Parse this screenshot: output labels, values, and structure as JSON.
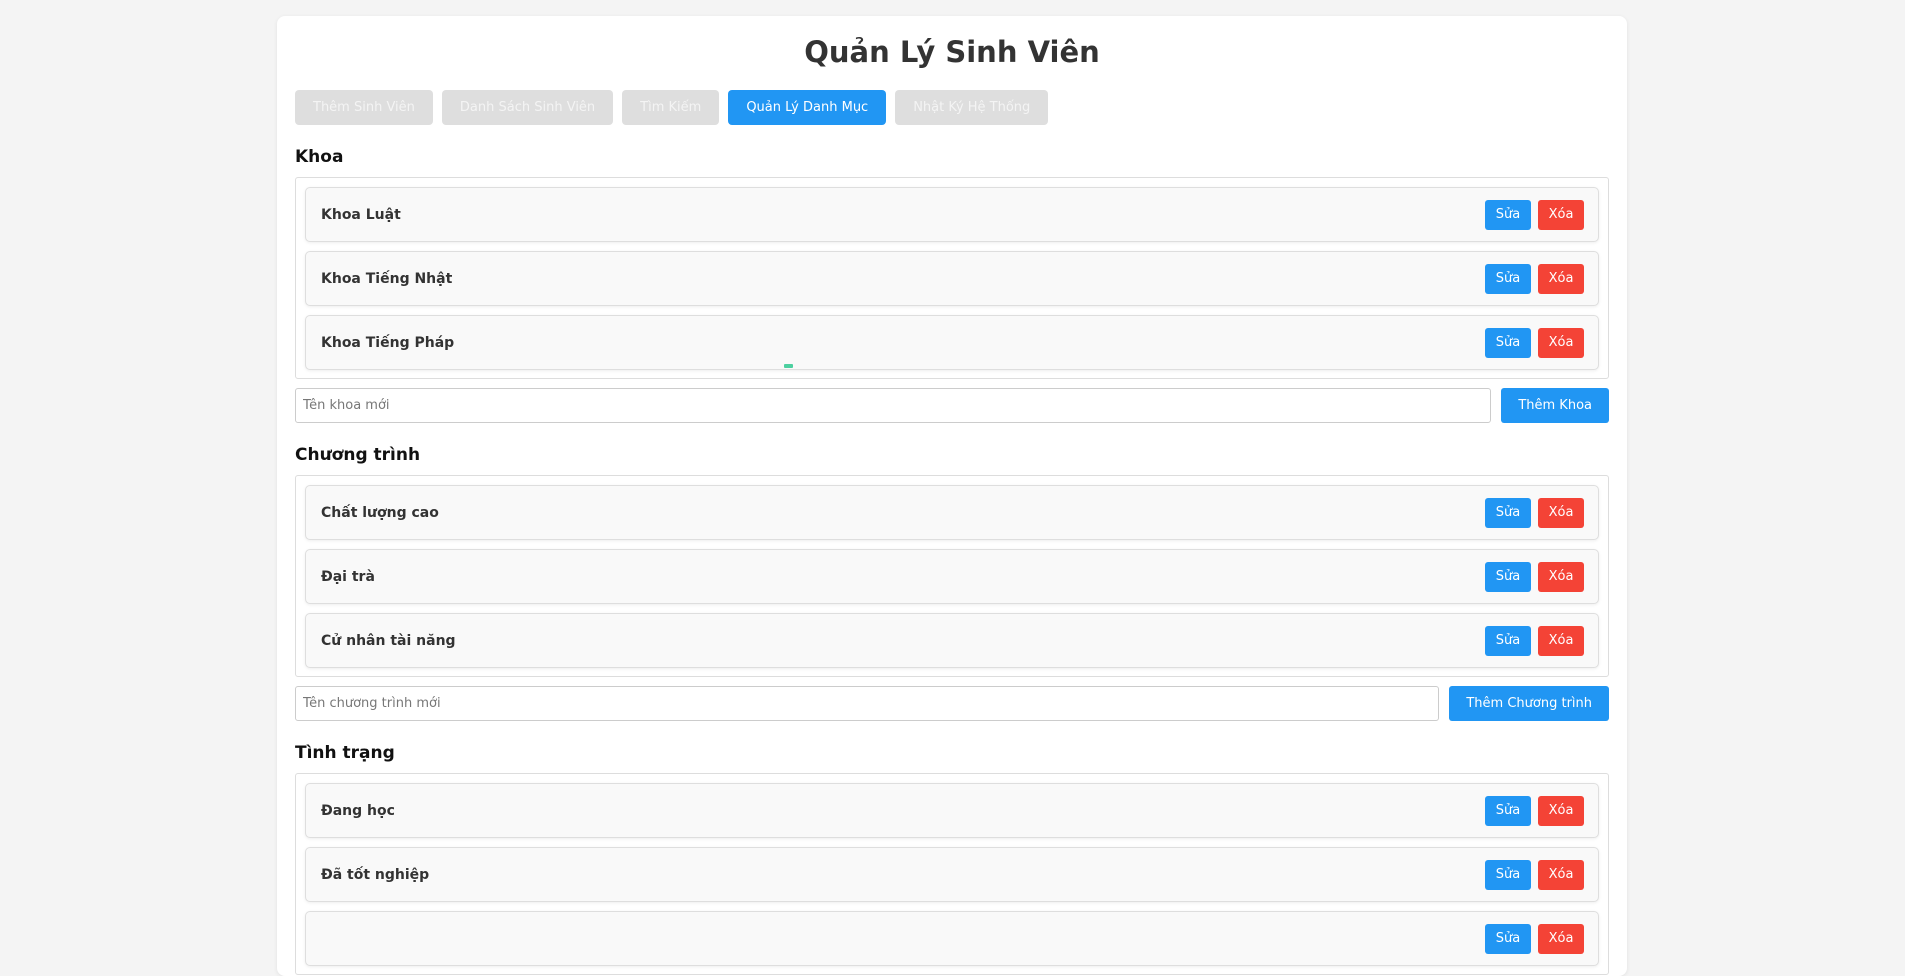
{
  "app": {
    "title": "Quản Lý Sinh Viên"
  },
  "tabs": [
    {
      "label": "Thêm Sinh Viên",
      "active": false
    },
    {
      "label": "Danh Sách Sinh Viên",
      "active": false
    },
    {
      "label": "Tìm Kiếm",
      "active": false
    },
    {
      "label": "Quản Lý Danh Mục",
      "active": true
    },
    {
      "label": "Nhật Ký Hệ Thống",
      "active": false
    }
  ],
  "common": {
    "edit_label": "Sửa",
    "delete_label": "Xóa"
  },
  "khoa": {
    "title": "Khoa",
    "items": [
      "Khoa Luật",
      "Khoa Tiếng Nhật",
      "Khoa Tiếng Pháp"
    ],
    "input_placeholder": "Tên khoa mới",
    "add_label": "Thêm Khoa"
  },
  "chuong_trinh": {
    "title": "Chương trình",
    "items": [
      "Chất lượng cao",
      "Đại trà",
      "Cử nhân tài năng"
    ],
    "input_placeholder": "Tên chương trình mới",
    "add_label": "Thêm Chương trình"
  },
  "tinh_trang": {
    "title": "Tình trạng",
    "items": [
      "Đang học",
      "Đã tốt nghiệp",
      ""
    ]
  },
  "colors": {
    "primary": "#2196f3",
    "danger": "#f44336",
    "tab_inactive": "#dedede"
  }
}
